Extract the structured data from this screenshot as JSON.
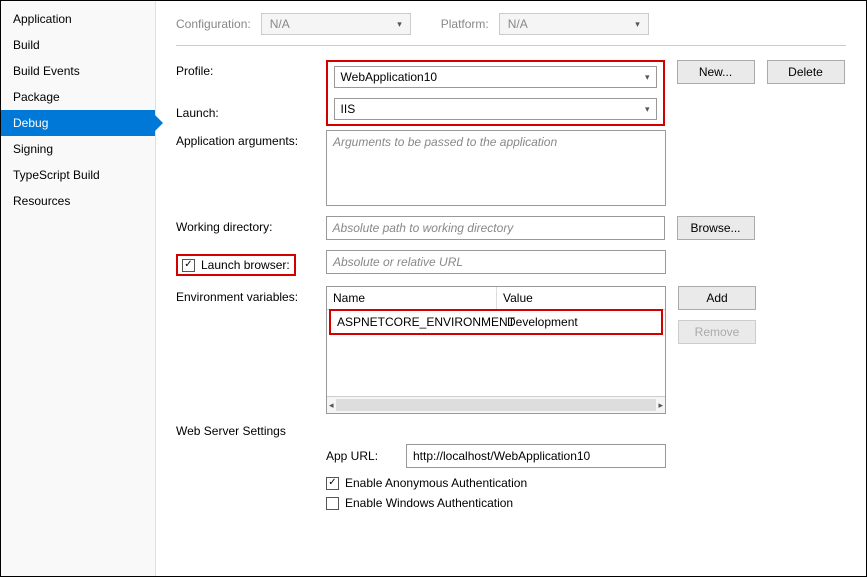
{
  "sidebar": {
    "items": [
      {
        "label": "Application"
      },
      {
        "label": "Build"
      },
      {
        "label": "Build Events"
      },
      {
        "label": "Package"
      },
      {
        "label": "Debug"
      },
      {
        "label": "Signing"
      },
      {
        "label": "TypeScript Build"
      },
      {
        "label": "Resources"
      }
    ]
  },
  "top": {
    "config_label": "Configuration:",
    "config_value": "N/A",
    "platform_label": "Platform:",
    "platform_value": "N/A"
  },
  "labels": {
    "profile": "Profile:",
    "launch": "Launch:",
    "app_args": "Application arguments:",
    "working_dir": "Working directory:",
    "launch_browser": "Launch browser:",
    "env_vars": "Environment variables:",
    "web_server": "Web Server Settings",
    "app_url": "App URL:",
    "enable_anon": "Enable Anonymous Authentication",
    "enable_win": "Enable Windows Authentication",
    "env_name": "Name",
    "env_value": "Value"
  },
  "buttons": {
    "new": "New...",
    "delete": "Delete",
    "browse": "Browse...",
    "add": "Add",
    "remove": "Remove"
  },
  "values": {
    "profile": "WebApplication10",
    "launch": "IIS",
    "app_args_placeholder": "Arguments to be passed to the application",
    "working_dir_placeholder": "Absolute path to working directory",
    "launch_browser_placeholder": "Absolute or relative URL",
    "app_url": "http://localhost/WebApplication10",
    "launch_browser_checked": "✓",
    "anon_checked": "✓"
  },
  "env": {
    "rows": [
      {
        "name": "ASPNETCORE_ENVIRONMENT",
        "value": "Development"
      }
    ]
  }
}
